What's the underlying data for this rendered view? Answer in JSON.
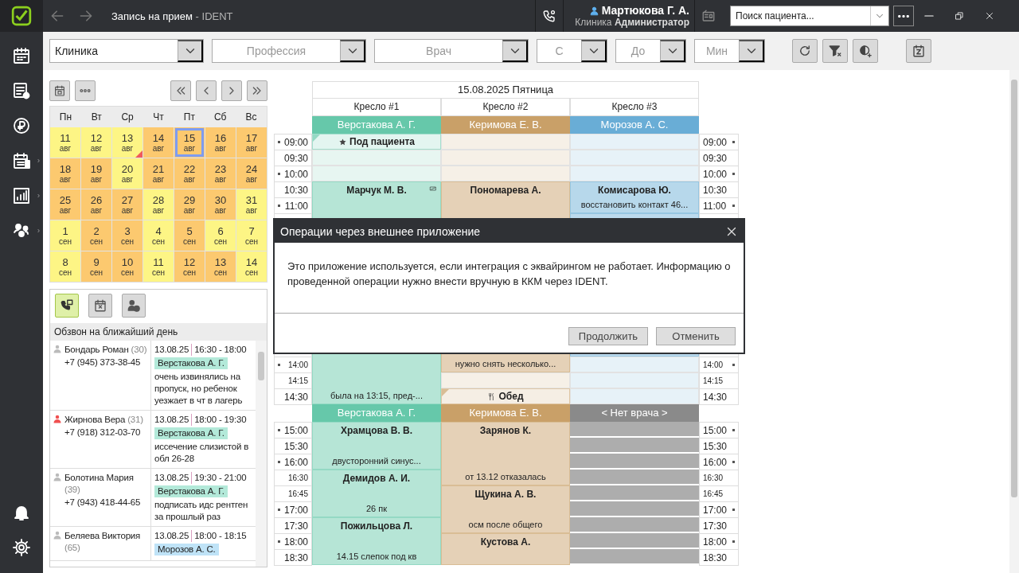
{
  "window": {
    "title": "Запись на прием",
    "suffix": "- IDENT"
  },
  "user": {
    "name": "Мартюкова Г. А.",
    "clinic": "Клиника",
    "role": "Администратор"
  },
  "search": {
    "placeholder": "Поиск пациента..."
  },
  "sidebar": {
    "items": [
      {
        "kind": "calendar",
        "submenu": false
      },
      {
        "kind": "list",
        "submenu": false
      },
      {
        "kind": "ruble",
        "submenu": false
      },
      {
        "kind": "cash-calendar",
        "submenu": true
      },
      {
        "kind": "chart",
        "submenu": true
      },
      {
        "kind": "people",
        "submenu": true
      }
    ],
    "bottom_items": [
      {
        "kind": "bell"
      },
      {
        "kind": "gear"
      }
    ]
  },
  "filters": [
    {
      "kind": "wide",
      "value": "Клиника"
    },
    {
      "kind": "wide",
      "placeholder": "Профессия"
    },
    {
      "kind": "wide",
      "placeholder": "Врач"
    },
    {
      "kind": "narrow",
      "placeholder": "С"
    },
    {
      "kind": "narrow",
      "placeholder": "До"
    },
    {
      "kind": "narrow",
      "placeholder": "Мин"
    }
  ],
  "toolbar_buttons": [
    {
      "kind": "refresh"
    },
    {
      "kind": "clear-filter"
    },
    {
      "kind": "clock"
    },
    {
      "kind": "calendar"
    }
  ],
  "calendar": {
    "tools": [
      {
        "kind": "today"
      },
      {
        "kind": "dots"
      }
    ],
    "nav": [
      {
        "kind": "first"
      },
      {
        "kind": "prev"
      },
      {
        "kind": "next"
      },
      {
        "kind": "last"
      }
    ],
    "weekdays": [
      "Пн",
      "Вт",
      "Ср",
      "Чт",
      "Пт",
      "Сб",
      "Вс"
    ],
    "weeks": [
      [
        {
          "day": "11",
          "month": "авг",
          "busy": false,
          "flag": false,
          "selected": false
        },
        {
          "day": "12",
          "month": "авг",
          "busy": false,
          "flag": false,
          "selected": false
        },
        {
          "day": "13",
          "month": "авг",
          "busy": false,
          "flag": true,
          "selected": false
        },
        {
          "day": "14",
          "month": "авг",
          "busy": true,
          "flag": false,
          "selected": false
        },
        {
          "day": "15",
          "month": "авг",
          "busy": true,
          "flag": false,
          "selected": true
        },
        {
          "day": "16",
          "month": "авг",
          "busy": true,
          "flag": false,
          "selected": false
        },
        {
          "day": "17",
          "month": "авг",
          "busy": true,
          "flag": false,
          "selected": false
        }
      ],
      [
        {
          "day": "18",
          "month": "авг",
          "busy": true,
          "flag": false,
          "selected": false
        },
        {
          "day": "19",
          "month": "авг",
          "busy": true,
          "flag": false,
          "selected": false
        },
        {
          "day": "20",
          "month": "авг",
          "busy": false,
          "flag": false,
          "selected": false
        },
        {
          "day": "21",
          "month": "авг",
          "busy": true,
          "flag": false,
          "selected": false
        },
        {
          "day": "22",
          "month": "авг",
          "busy": true,
          "flag": false,
          "selected": false
        },
        {
          "day": "23",
          "month": "авг",
          "busy": true,
          "flag": false,
          "selected": false
        },
        {
          "day": "24",
          "month": "авг",
          "busy": true,
          "flag": false,
          "selected": false
        }
      ],
      [
        {
          "day": "25",
          "month": "авг",
          "busy": true,
          "flag": false,
          "selected": false
        },
        {
          "day": "26",
          "month": "авг",
          "busy": true,
          "flag": false,
          "selected": false
        },
        {
          "day": "27",
          "month": "авг",
          "busy": true,
          "flag": false,
          "selected": false
        },
        {
          "day": "28",
          "month": "авг",
          "busy": false,
          "flag": false,
          "selected": false
        },
        {
          "day": "29",
          "month": "авг",
          "busy": true,
          "flag": false,
          "selected": false
        },
        {
          "day": "30",
          "month": "авг",
          "busy": true,
          "flag": false,
          "selected": false
        },
        {
          "day": "31",
          "month": "авг",
          "busy": false,
          "flag": false,
          "selected": false
        }
      ],
      [
        {
          "day": "1",
          "month": "сен",
          "busy": false,
          "flag": false,
          "selected": false
        },
        {
          "day": "2",
          "month": "сен",
          "busy": true,
          "flag": false,
          "selected": false
        },
        {
          "day": "3",
          "month": "сен",
          "busy": true,
          "flag": false,
          "selected": false
        },
        {
          "day": "4",
          "month": "сен",
          "busy": false,
          "flag": false,
          "selected": false
        },
        {
          "day": "5",
          "month": "сен",
          "busy": true,
          "flag": false,
          "selected": false
        },
        {
          "day": "6",
          "month": "сен",
          "busy": false,
          "flag": false,
          "selected": false
        },
        {
          "day": "7",
          "month": "сен",
          "busy": false,
          "flag": false,
          "selected": false
        }
      ],
      [
        {
          "day": "8",
          "month": "сен",
          "busy": false,
          "flag": false,
          "selected": false
        },
        {
          "day": "9",
          "month": "сен",
          "busy": true,
          "flag": false,
          "selected": false
        },
        {
          "day": "10",
          "month": "сен",
          "busy": true,
          "flag": false,
          "selected": false
        },
        {
          "day": "11",
          "month": "сен",
          "busy": false,
          "flag": false,
          "selected": false
        },
        {
          "day": "12",
          "month": "сен",
          "busy": true,
          "flag": false,
          "selected": false
        },
        {
          "day": "13",
          "month": "сен",
          "busy": true,
          "flag": false,
          "selected": false
        },
        {
          "day": "14",
          "month": "сен",
          "busy": false,
          "flag": false,
          "selected": false
        }
      ]
    ]
  },
  "calls": {
    "tabs": [
      {
        "kind": "phone-calendar",
        "selected": true
      },
      {
        "kind": "calendar-cross",
        "selected": false
      },
      {
        "kind": "person-clock",
        "selected": false
      }
    ],
    "title": "Обзвон на ближайший день",
    "entries": [
      {
        "name": "Бондарь Роман",
        "age": "(30)",
        "phone": "+7 (945) 373-38-45",
        "date": "13.08.25",
        "time": "16:30 - 18:00",
        "doctor": "Верстакова А. Г.",
        "color": "#b3e9d9",
        "note": "очень извинялись на пропуск, но ребенок уезжает в чт в лагерь",
        "flagged": false
      },
      {
        "name": "Жирнова Вера",
        "age": "(31)",
        "phone": "+7 (918) 312-03-70",
        "date": "13.08.25",
        "time": "18:00 - 19:30",
        "doctor": "Верстакова А. Г.",
        "color": "#b3e9d9",
        "note": "иссечение слизистой в обл 26-28",
        "flagged": true
      },
      {
        "name": "Болотина Мария",
        "age": "(39)",
        "phone": "+7 (943) 418-44-65",
        "date": "13.08.25",
        "time": "19:30 - 21:00",
        "doctor": "Верстакова А. Г.",
        "color": "#b3e9d9",
        "note": "подписать идс рентген за прошлый раз",
        "flagged": false
      },
      {
        "name": "Беляева Виктория",
        "age": "(65)",
        "date": "13.08.25",
        "time": "18:00 - 18:15",
        "doctor": "Морозов А. С.",
        "color": "#bfe3f7",
        "flagged": false
      }
    ]
  },
  "schedule": {
    "date": "15.08.2025 Пятница",
    "chairs": [
      "Кресло #1",
      "Кресло #2",
      "Кресло #3"
    ],
    "sections": [
      {
        "doctors": [
          {
            "name": "Верстакова А. Г.",
            "color": "#66c8aa"
          },
          {
            "name": "Керимова Е. В.",
            "color": "#c9a068"
          },
          {
            "name": "Морозов А. С.",
            "color": "#69add6"
          }
        ],
        "rows": [
          {
            "left": "09:00",
            "right": "09:00",
            "hour": true,
            "compact": false,
            "cells": [
              {
                "kind": "reserved",
                "label": "Под пациента"
              },
              {
                "kind": "free"
              },
              {
                "kind": "free"
              }
            ]
          },
          {
            "left": "09:30",
            "right": "09:30",
            "hour": false,
            "compact": false,
            "cells": [
              {
                "kind": "free"
              },
              {
                "kind": "free"
              },
              {
                "kind": "free"
              }
            ]
          },
          {
            "left": "10:00",
            "right": "10:00",
            "hour": true,
            "compact": false,
            "cells": [
              {
                "kind": "free"
              },
              {
                "kind": "free"
              },
              {
                "kind": "free"
              }
            ]
          },
          {
            "left": "10:30",
            "right": "10:30",
            "hour": false,
            "compact": false,
            "cells": [
              {
                "kind": "appt",
                "name": "Марчук М. В.",
                "note": "была на 13:15, пред-...",
                "message": true
              },
              {
                "kind": "appt",
                "name": "Пономарева А.",
                "note": "нужно снять несколько...",
                "message": false
              },
              {
                "kind": "appt",
                "name": "Комисарова Ю.",
                "note": "восстановить контакт 46...",
                "message": false
              }
            ]
          },
          {
            "left": "11:00",
            "right": "11:00",
            "hour": true,
            "compact": false,
            "cells": [
              {
                "kind": "cont"
              },
              {
                "kind": "cont"
              },
              {
                "kind": "cont"
              }
            ]
          },
          {
            "cells": [
              {
                "kind": "cont"
              },
              {
                "kind": "cont"
              },
              {
                "kind": "busy"
              }
            ]
          },
          {
            "cells": [
              {
                "kind": "cont"
              },
              {
                "kind": "cont"
              },
              {
                "kind": "cont"
              }
            ]
          },
          {
            "cells": [
              {
                "kind": "cont"
              },
              {
                "kind": "cont"
              },
              {
                "kind": "cont"
              }
            ]
          },
          {
            "cells": [
              {
                "kind": "cont"
              },
              {
                "kind": "cont"
              },
              {
                "kind": "cont"
              }
            ]
          },
          {
            "cells": [
              {
                "kind": "cont"
              },
              {
                "kind": "cont"
              },
              {
                "kind": "cont"
              }
            ]
          },
          {
            "cells": [
              {
                "kind": "cont"
              },
              {
                "kind": "cont"
              },
              {
                "kind": "cont"
              }
            ]
          },
          {
            "cells": [
              {
                "kind": "cont"
              },
              {
                "kind": "cont"
              },
              {
                "kind": "cont"
              }
            ]
          },
          {
            "cells": [
              {
                "kind": "cont"
              },
              {
                "kind": "cont"
              },
              {
                "kind": "cont"
              }
            ]
          },
          {
            "cells": [
              {
                "kind": "cont"
              },
              {
                "kind": "cont"
              },
              {
                "kind": "cont"
              }
            ]
          },
          {
            "left": "14:00",
            "right": "14:00",
            "hour": true,
            "compact": true,
            "cells": [
              {
                "kind": "cont"
              },
              {
                "kind": "cont"
              },
              {
                "kind": "free"
              }
            ]
          },
          {
            "left": "14:15",
            "right": "14:15",
            "hour": false,
            "compact": true,
            "cells": [
              {
                "kind": "cont"
              },
              {
                "kind": "free"
              },
              {
                "kind": "free"
              }
            ]
          },
          {
            "left": "14:30",
            "right": "14:30",
            "hour": false,
            "compact": false,
            "cells": [
              {
                "kind": "cont"
              },
              {
                "kind": "lunch",
                "label": "Обед"
              },
              {
                "kind": "free"
              }
            ]
          }
        ]
      },
      {
        "doctors": [
          {
            "name": "Верстакова А. Г.",
            "color": "#66c8aa"
          },
          {
            "name": "Керимова Е. В.",
            "color": "#c9a068"
          },
          {
            "name": "< Нет врача >",
            "color": "#8a8a8a"
          }
        ],
        "rows": [
          {
            "left": "15:00",
            "right": "15:00",
            "hour": true,
            "compact": false,
            "cells": [
              {
                "kind": "appt",
                "name": "Храмцова В. В.",
                "note": "двусторонний синус...",
                "message": false
              },
              {
                "kind": "appt",
                "name": "Зарянов К.",
                "note": "от 13.12 отказалась",
                "message": false
              },
              {
                "kind": "off"
              }
            ]
          },
          {
            "left": "15:30",
            "right": "15:30",
            "hour": false,
            "compact": false,
            "cells": [
              {
                "kind": "cont"
              },
              {
                "kind": "cont"
              },
              {
                "kind": "off"
              }
            ]
          },
          {
            "left": "16:00",
            "right": "16:00",
            "hour": true,
            "compact": false,
            "cells": [
              {
                "kind": "cont"
              },
              {
                "kind": "cont"
              },
              {
                "kind": "off"
              }
            ]
          },
          {
            "left": "16:30",
            "right": "16:30",
            "hour": false,
            "compact": true,
            "cells": [
              {
                "kind": "appt",
                "name": "Демидов А. И.",
                "note": "26 пк",
                "message": false
              },
              {
                "kind": "cont"
              },
              {
                "kind": "off"
              }
            ]
          },
          {
            "left": "16:45",
            "right": "16:45",
            "hour": false,
            "compact": true,
            "cells": [
              {
                "kind": "cont"
              },
              {
                "kind": "appt",
                "name": "Щукина А. В.",
                "note": "осм после общего",
                "message": false
              },
              {
                "kind": "off"
              }
            ]
          },
          {
            "left": "17:00",
            "right": "17:00",
            "hour": true,
            "compact": false,
            "cells": [
              {
                "kind": "cont"
              },
              {
                "kind": "cont"
              },
              {
                "kind": "off"
              }
            ]
          },
          {
            "left": "17:30",
            "right": "17:30",
            "hour": false,
            "compact": false,
            "cells": [
              {
                "kind": "appt",
                "name": "Пожильцова Л.",
                "note": "14.15 слепок под кв",
                "message": false
              },
              {
                "kind": "cont"
              },
              {
                "kind": "off"
              }
            ]
          },
          {
            "left": "18:00",
            "right": "18:00",
            "hour": true,
            "compact": false,
            "cells": [
              {
                "kind": "cont"
              },
              {
                "kind": "appt",
                "name": "Кустова А.",
                "message": false
              },
              {
                "kind": "off"
              }
            ]
          },
          {
            "left": "18:30",
            "right": "18:30",
            "hour": false,
            "compact": false,
            "cells": [
              {
                "kind": "cont"
              },
              {
                "kind": "cont"
              },
              {
                "kind": "off"
              }
            ]
          }
        ]
      }
    ]
  },
  "dialog": {
    "title": "Операции через внешнее приложение",
    "message": "Это приложение используется, если интеграция с эквайрингом не работает. Информацию о проведенной операции нужно внести вручную в ККМ через IDENT.",
    "buttons": [
      "Продолжить",
      "Отменить"
    ]
  }
}
